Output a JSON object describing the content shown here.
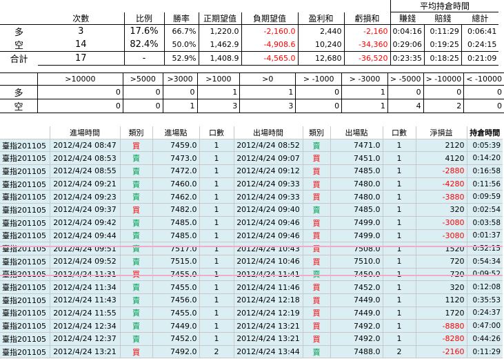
{
  "summary": {
    "group_header": "平均持倉時間",
    "headers": [
      "",
      "次數",
      "比例",
      "勝率",
      "正期望值",
      "負期望值",
      "盈利和",
      "虧損和",
      "賺錢",
      "賠錢",
      "總計"
    ],
    "rows": [
      {
        "label": "多",
        "count": "3",
        "ratio": "17.6%",
        "winrate": "66.7%",
        "pos_ev": "1,220.0",
        "neg_ev": "-2,160.0",
        "profit": "2,440",
        "loss": "-2,160",
        "t_win": "0:04:16",
        "t_loss": "0:11:29",
        "t_total": "0:06:41"
      },
      {
        "label": "空",
        "count": "14",
        "ratio": "82.4%",
        "winrate": "50.0%",
        "pos_ev": "1,462.9",
        "neg_ev": "-4,908.6",
        "profit": "10,240",
        "loss": "-34,360",
        "t_win": "0:29:06",
        "t_loss": "0:19:25",
        "t_total": "0:24:15"
      },
      {
        "label": "合計",
        "count": "17",
        "ratio": "-",
        "winrate": "52.9%",
        "pos_ev": "1,408.9",
        "neg_ev": "-4,565.0",
        "profit": "12,680",
        "loss": "-36,520",
        "t_win": "0:23:35",
        "t_loss": "0:18:25",
        "t_total": "0:21:09"
      }
    ]
  },
  "thresholds": {
    "headers": [
      ">10000",
      ">5000",
      ">3000",
      ">1000",
      ">0",
      "> -1000",
      "> -3000",
      "> -5000",
      "> -10000",
      "< -10000"
    ],
    "rows": [
      {
        "label": "多",
        "values": [
          "0",
          "0",
          "0",
          "1",
          "1",
          "0",
          "1",
          "0",
          "0",
          "0"
        ]
      },
      {
        "label": "空",
        "values": [
          "0",
          "0",
          "1",
          "3",
          "3",
          "0",
          "1",
          "4",
          "2",
          "0"
        ]
      }
    ]
  },
  "trades": {
    "headers": [
      "",
      "進場時間",
      "類別",
      "進場點",
      "口數",
      "出場時間",
      "類別",
      "出場點",
      "口數",
      "淨損益",
      "持倉時間"
    ],
    "rows": [
      {
        "contract": "臺指201105",
        "entry_time": "2012/4/24 08:47",
        "entry_type": "買",
        "entry_price": "7459.0",
        "entry_qty": "1",
        "exit_time": "2012/4/24 08:52",
        "exit_type": "賣",
        "exit_price": "7471.0",
        "exit_qty": "1",
        "pnl": "2120",
        "hold": "0:05:39"
      },
      {
        "contract": "臺指201105",
        "entry_time": "2012/4/24 08:53",
        "entry_type": "賣",
        "entry_price": "7473.0",
        "entry_qty": "1",
        "exit_time": "2012/4/24 09:07",
        "exit_type": "買",
        "exit_price": "7451.0",
        "exit_qty": "1",
        "pnl": "4120",
        "hold": "0:14:20"
      },
      {
        "contract": "臺指201105",
        "entry_time": "2012/4/24 08:55",
        "entry_type": "賣",
        "entry_price": "7472.0",
        "entry_qty": "1",
        "exit_time": "2012/4/24 09:12",
        "exit_type": "買",
        "exit_price": "7485.0",
        "exit_qty": "1",
        "pnl": "-2880",
        "hold": "0:16:58"
      },
      {
        "contract": "臺指201105",
        "entry_time": "2012/4/24 09:21",
        "entry_type": "賣",
        "entry_price": "7460.0",
        "entry_qty": "1",
        "exit_time": "2012/4/24 09:33",
        "exit_type": "買",
        "exit_price": "7480.0",
        "exit_qty": "1",
        "pnl": "-4280",
        "hold": "0:11:56"
      },
      {
        "contract": "臺指201105",
        "entry_time": "2012/4/24 09:23",
        "entry_type": "賣",
        "entry_price": "7462.0",
        "entry_qty": "1",
        "exit_time": "2012/4/24 09:33",
        "exit_type": "買",
        "exit_price": "7480.0",
        "exit_qty": "1",
        "pnl": "-3880",
        "hold": "0:09:59"
      },
      {
        "contract": "臺指201105",
        "entry_time": "2012/4/24 09:37",
        "entry_type": "買",
        "entry_price": "7482.0",
        "entry_qty": "1",
        "exit_time": "2012/4/24 09:40",
        "exit_type": "賣",
        "exit_price": "7485.0",
        "exit_qty": "1",
        "pnl": "320",
        "hold": "0:02:54"
      },
      {
        "contract": "臺指201105",
        "entry_time": "2012/4/24 09:42",
        "entry_type": "賣",
        "entry_price": "7485.0",
        "entry_qty": "1",
        "exit_time": "2012/4/24 09:46",
        "exit_type": "買",
        "exit_price": "7499.0",
        "exit_qty": "1",
        "pnl": "-3080",
        "hold": "0:03:58"
      },
      {
        "contract": "臺指201105",
        "entry_time": "2012/4/24 09:44",
        "entry_type": "賣",
        "entry_price": "7485.0",
        "entry_qty": "1",
        "exit_time": "2012/4/24 09:46",
        "exit_type": "買",
        "exit_price": "7499.0",
        "exit_qty": "1",
        "pnl": "-3080",
        "hold": "0:01:37"
      },
      {
        "contract": "臺指201105",
        "entry_time": "2012/4/24 09:51",
        "entry_type": "賣",
        "entry_price": "7517.0",
        "entry_qty": "1",
        "exit_time": "2012/4/24 10:43",
        "exit_type": "買",
        "exit_price": "7508.0",
        "exit_qty": "1",
        "pnl": "1520",
        "hold": "0:52:15"
      },
      {
        "contract": "臺指201105",
        "entry_time": "2012/4/24 09:52",
        "entry_type": "賣",
        "entry_price": "7515.0",
        "entry_qty": "1",
        "exit_time": "2012/4/24 10:46",
        "exit_type": "買",
        "exit_price": "7510.0",
        "exit_qty": "1",
        "pnl": "720",
        "hold": "0:54:34"
      },
      {
        "contract": "臺指201105",
        "entry_time": "2012/4/24 11:31",
        "entry_type": "買",
        "entry_price": "7455.0",
        "entry_qty": "1",
        "exit_time": "2012/4/24 11:41",
        "exit_type": "賣",
        "exit_price": "7450.0",
        "exit_qty": "1",
        "pnl": "720",
        "hold": "0:09:52"
      },
      {
        "contract": "臺指201105",
        "entry_time": "2012/4/24 11:34",
        "entry_type": "賣",
        "entry_price": "7455.0",
        "entry_qty": "1",
        "exit_time": "2012/4/24 11:46",
        "exit_type": "買",
        "exit_price": "7452.0",
        "exit_qty": "1",
        "pnl": "320",
        "hold": "0:12:08"
      },
      {
        "contract": "臺指201105",
        "entry_time": "2012/4/24 11:43",
        "entry_type": "賣",
        "entry_price": "7456.0",
        "entry_qty": "1",
        "exit_time": "2012/4/24 12:18",
        "exit_type": "買",
        "exit_price": "7449.0",
        "exit_qty": "1",
        "pnl": "1120",
        "hold": "0:35:53"
      },
      {
        "contract": "臺指201105",
        "entry_time": "2012/4/24 11:55",
        "entry_type": "賣",
        "entry_price": "7455.0",
        "entry_qty": "1",
        "exit_time": "2012/4/24 12:19",
        "exit_type": "買",
        "exit_price": "7449.0",
        "exit_qty": "1",
        "pnl": "1720",
        "hold": "0:24:37"
      },
      {
        "contract": "臺指201105",
        "entry_time": "2012/4/24 12:34",
        "entry_type": "賣",
        "entry_price": "7449.0",
        "entry_qty": "1",
        "exit_time": "2012/4/24 13:21",
        "exit_type": "買",
        "exit_price": "7492.0",
        "exit_qty": "1",
        "pnl": "-8880",
        "hold": "0:47:00"
      },
      {
        "contract": "臺指201105",
        "entry_time": "2012/4/24 12:37",
        "entry_type": "賣",
        "entry_price": "7452.0",
        "entry_qty": "1",
        "exit_time": "2012/4/24 13:21",
        "exit_type": "買",
        "exit_price": "7492.0",
        "exit_qty": "1",
        "pnl": "-8280",
        "hold": "0:44:26"
      },
      {
        "contract": "臺指201105",
        "entry_time": "2012/4/24 13:21",
        "entry_type": "買",
        "entry_price": "7492.0",
        "entry_qty": "2",
        "exit_time": "2012/4/24 13:44",
        "exit_type": "賣",
        "exit_price": "7488.0",
        "exit_qty": "2",
        "pnl": "-2160",
        "hold": "0:11:29"
      }
    ]
  },
  "colors": {
    "row_fill": "#daeef3",
    "buy": "#ff0000",
    "sell": "#00a050",
    "negative": "#ff0000",
    "highlight_border": "#f4a9c6"
  }
}
